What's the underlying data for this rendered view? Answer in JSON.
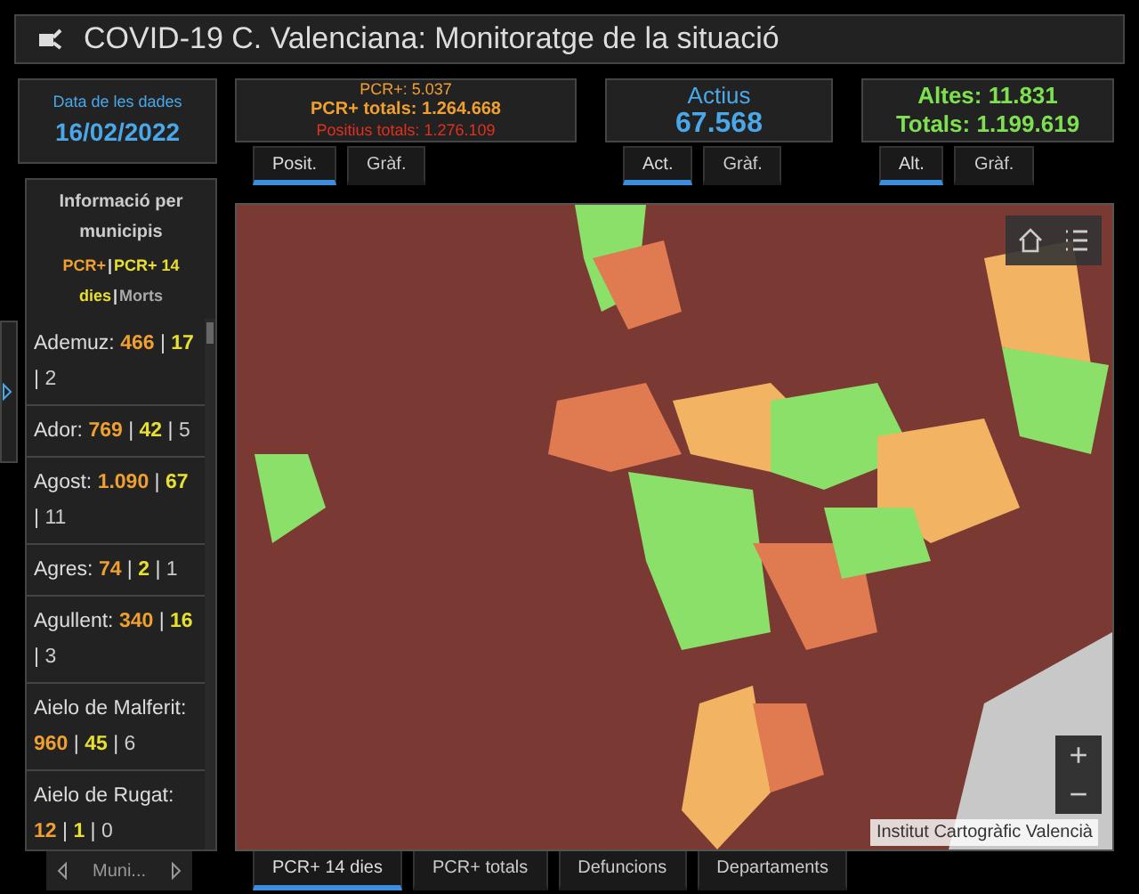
{
  "header": {
    "title": "COVID-19 C. Valenciana: Monitoratge de la situació"
  },
  "date_panel": {
    "label": "Data de les dades",
    "value": "16/02/2022"
  },
  "panels": [
    {
      "kind": "pcr",
      "lines": [
        "PCR+: 5.037",
        "PCR+ totals: 1.264.668",
        "Positius totals: 1.276.109"
      ],
      "tabs": [
        {
          "label": "Posit.",
          "selected": true
        },
        {
          "label": "Gràf.",
          "selected": false
        }
      ]
    },
    {
      "kind": "actius",
      "lines": [
        "Actius",
        "67.568"
      ],
      "tabs": [
        {
          "label": "Act.",
          "selected": true
        },
        {
          "label": "Gràf.",
          "selected": false
        }
      ]
    },
    {
      "kind": "altes",
      "lines": [
        "Altes: 11.831",
        "Totals: 1.199.619"
      ],
      "tabs": [
        {
          "label": "Alt.",
          "selected": true
        },
        {
          "label": "Gràf.",
          "selected": false
        }
      ]
    }
  ],
  "sidebar": {
    "title": "Informació per municipis",
    "separator": "|",
    "legend": [
      "PCR+",
      "PCR+ 14 dies",
      "Morts"
    ],
    "items": [
      {
        "name": "Ademuz:",
        "pcr": "466",
        "pcr14": "17",
        "deaths": "2"
      },
      {
        "name": "Ador:",
        "pcr": "769",
        "pcr14": "42",
        "deaths": "5"
      },
      {
        "name": "Agost:",
        "pcr": "1.090",
        "pcr14": "67",
        "deaths": "11"
      },
      {
        "name": "Agres:",
        "pcr": "74",
        "pcr14": "2",
        "deaths": "1"
      },
      {
        "name": "Agullent:",
        "pcr": "340",
        "pcr14": "16",
        "deaths": "3"
      },
      {
        "name": "Aielo de Malferit:",
        "pcr": "960",
        "pcr14": "45",
        "deaths": "6"
      },
      {
        "name": "Aielo de Rugat:",
        "pcr": "12",
        "pcr14": "1",
        "deaths": "0"
      }
    ],
    "pager": {
      "label": "Muni..."
    }
  },
  "map": {
    "attribution": "Institut Cartogràfic Valencià",
    "zoom_in": "+",
    "zoom_out": "−"
  },
  "bottom_tabs": [
    {
      "label": "PCR+ 14 dies",
      "selected": true
    },
    {
      "label": "PCR+ totals",
      "selected": false
    },
    {
      "label": "Defuncions",
      "selected": false
    },
    {
      "label": "Departaments",
      "selected": false
    }
  ]
}
